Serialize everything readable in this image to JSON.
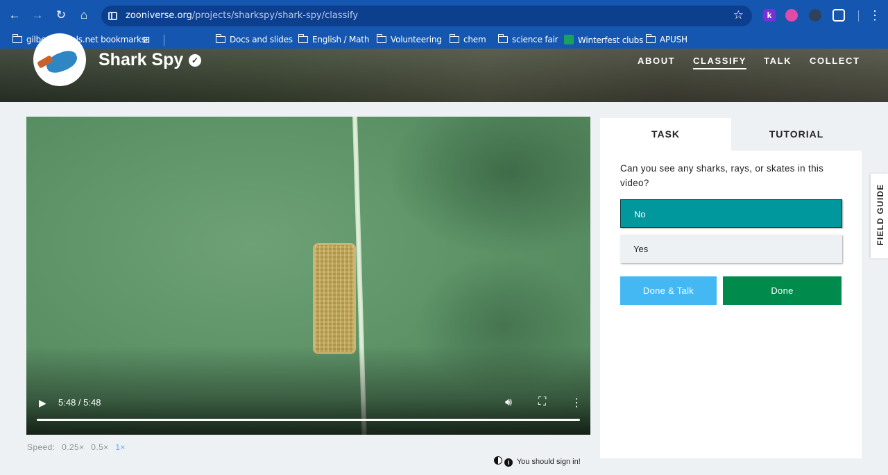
{
  "browser": {
    "url_host": "zooniverse.org",
    "url_path": "/projects/sharkspy/shark-spy/classify",
    "bookmarks": [
      "gilbertschools.net bookmarks",
      "Docs and slides",
      "English / Math",
      "Volunteering",
      "chem",
      "science fair",
      "Winterfest clubs",
      "APUSH"
    ],
    "extensions": {
      "k_label": "k"
    },
    "colors": {
      "chrome": "#1557b0",
      "omnibox": "#0d3f8f"
    }
  },
  "project": {
    "title": "Shark Spy",
    "nav": [
      "ABOUT",
      "CLASSIFY",
      "TALK",
      "COLLECT"
    ],
    "active_nav": "CLASSIFY"
  },
  "video": {
    "time": "5:48 / 5:48",
    "progress_fraction": 1.0,
    "speed_label": "Speed:",
    "speeds": [
      "0.25×",
      "0.5×",
      "1×"
    ],
    "selected_speed": "1×"
  },
  "signin": {
    "text": "You should sign in!"
  },
  "task": {
    "tabs": [
      "TASK",
      "TUTORIAL"
    ],
    "question": "Can you see any sharks, rays, or skates in this video?",
    "answers": [
      "No",
      "Yes"
    ],
    "selected_answer": "No",
    "done_talk_label": "Done & Talk",
    "done_label": "Done",
    "colors": {
      "selected": "#00979d",
      "done_talk": "#43b8f3",
      "done": "#008b4d"
    }
  },
  "field_guide": {
    "label": "FIELD GUIDE"
  }
}
